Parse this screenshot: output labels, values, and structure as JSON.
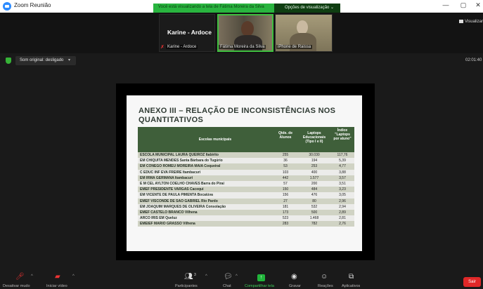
{
  "window": {
    "title": "Zoom Reunião",
    "controls": [
      "—",
      "▢",
      "✕"
    ]
  },
  "share_banner": {
    "text": "Você está visualizando a tela de Fátima Moreira da Silva",
    "view_options": "Opções de visualização",
    "color": "#29b53f"
  },
  "participants": {
    "karine_name": "Karine - Ardoce",
    "karine_label": "Karine - Ardoce",
    "fatima_label": "Fátima Moreira da Silva",
    "raissa_label": "iPhone de Raissa"
  },
  "view_button": "Visualizar",
  "sound": {
    "label": "Som original: desligado",
    "caret": "▾"
  },
  "timer": "02:01:40",
  "slide": {
    "title": "ANEXO III – RELAÇÃO DE INCONSISTÊNCIAS NOS QUANTITATIVOS",
    "headers": {
      "escolas": "Escolas municipais",
      "qtde": "Qtde. de Alunos",
      "laptops": "Laptops Educacionais (Tipo I e II)",
      "indice": "Índice \"Laptops por aluno\""
    },
    "rows": [
      {
        "escola": "ESCOLA MUNICIPAL LAURA QUEIROZ Itabirito",
        "qtde": "255",
        "laptops": "30.030",
        "indice": "117,76"
      },
      {
        "escola": "EM CHIQUITA MENDES Santa Bárbara do Tugúrio",
        "qtde": "36",
        "laptops": "194",
        "indice": "5,39"
      },
      {
        "escola": "EM CONEGO ROMEU MOREIRA MAIA Coqueiral",
        "qtde": "53",
        "laptops": "253",
        "indice": "4,77"
      },
      {
        "escola": "C EDUC INF EVA FREIRE Itambacuri",
        "qtde": "103",
        "laptops": "400",
        "indice": "3,88"
      },
      {
        "escola": "EM IRMA GERMANA Itambacuri",
        "qtde": "442",
        "laptops": "1.577",
        "indice": "3,57"
      },
      {
        "escola": "E M CEL AYLTON COELHO CHAVES Barra do Piraí",
        "qtde": "57",
        "laptops": "200",
        "indice": "3,51"
      },
      {
        "escola": "EMEF PRESIDENTE VARGAS Cacequi",
        "qtde": "150",
        "laptops": "484",
        "indice": "3,23"
      },
      {
        "escola": "EM VICENTE DE PAULA PIMENTA Bocaiúva",
        "qtde": "156",
        "laptops": "476",
        "indice": "3,05"
      },
      {
        "escola": "EMEF VISCONDE DE SAO GABRIEL Rio Pardo",
        "qtde": "27",
        "laptops": "80",
        "indice": "2,96"
      },
      {
        "escola": "EM JOAQUIM MARQUES DE OLIVEIRA Consolação",
        "qtde": "181",
        "laptops": "532",
        "indice": "2,94"
      },
      {
        "escola": "EMEF CASTELO BRANCO Vilhena",
        "qtde": "173",
        "laptops": "500",
        "indice": "2,89"
      },
      {
        "escola": "ARCO IRIS EM Queluz",
        "qtde": "523",
        "laptops": "1.468",
        "indice": "2,81"
      },
      {
        "escola": "EMEIEF MARIO GRASSO Vilhena",
        "qtde": "283",
        "laptops": "782",
        "indice": "2,76"
      }
    ],
    "header_color": "#3f5f3a"
  },
  "toolbar": {
    "mute": "Desativar mudo",
    "video": "Iniciar vídeo",
    "participants": "Participantes",
    "participants_count": "3",
    "chat": "Chat",
    "share": "Compartilhar tela",
    "record": "Gravar",
    "reactions": "Reações",
    "apps": "Aplicativos",
    "leave": "Sair",
    "leave_color": "#e02828"
  }
}
